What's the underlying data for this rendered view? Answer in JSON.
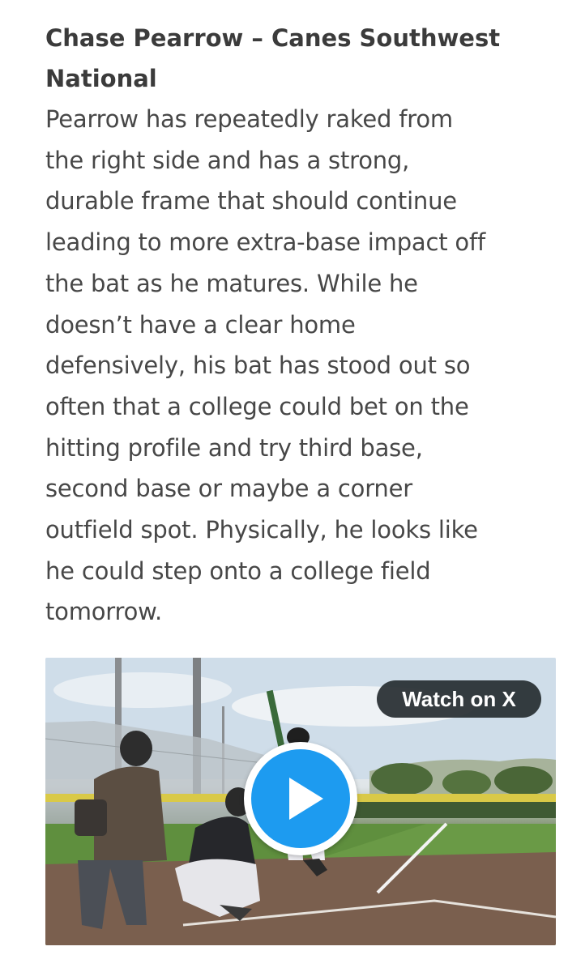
{
  "article": {
    "heading_line1": "Chase Pearrow – Canes Southwest",
    "heading_line2": "National",
    "body_lines": [
      "Pearrow has repeatedly raked from",
      "the right side and has a strong,",
      "durable frame that should continue",
      "leading to more extra-base impact off",
      "the bat as he matures. While he",
      "doesn’t have a clear home",
      "defensively, his bat has stood out so",
      "often that a college could bet on the",
      "hitting profile and try third base,",
      "second base or maybe a corner",
      "outfield spot. Physically, he looks like",
      "he could step onto a college field",
      "tomorrow."
    ]
  },
  "video": {
    "watch_label": "Watch on X",
    "play_icon": "play-icon",
    "play_color": "#1d9bf0"
  }
}
